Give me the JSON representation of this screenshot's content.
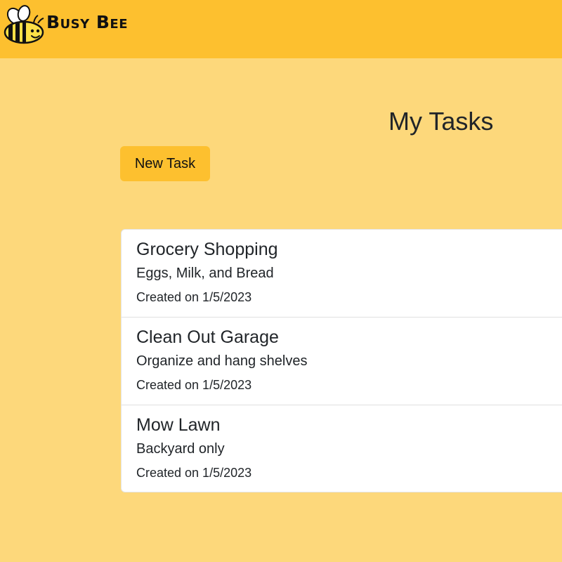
{
  "navbar": {
    "brand": "Busy Bee",
    "logo_icon": "bee-icon"
  },
  "main": {
    "title": "My Tasks",
    "new_task_label": "New Task",
    "tasks": [
      {
        "title": "Grocery Shopping",
        "description": "Eggs, Milk, and Bread",
        "created": "Created on 1/5/2023"
      },
      {
        "title": "Clean Out Garage",
        "description": "Organize and hang shelves",
        "created": "Created on 1/5/2023"
      },
      {
        "title": "Mow Lawn",
        "description": "Backyard only",
        "created": "Created on 1/5/2023"
      }
    ]
  },
  "colors": {
    "page_background": "#fdd87b",
    "navbar_background": "#fdc02f",
    "button_background": "#fdc02f",
    "card_background": "#ffffff",
    "text": "#212529"
  }
}
